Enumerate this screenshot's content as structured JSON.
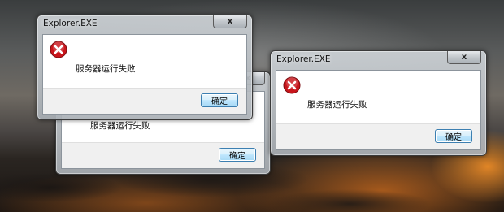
{
  "dialogs": [
    {
      "title": "",
      "message": "服务器运行失败",
      "ok_label": "确定",
      "close_glyph": "x",
      "icon": "error-icon"
    },
    {
      "title": "Explorer.EXE",
      "message": "服务器运行失败",
      "ok_label": "确定",
      "close_glyph": "x",
      "icon": "error-icon"
    },
    {
      "title": "Explorer.EXE",
      "message": "服务器运行失败",
      "ok_label": "确定",
      "close_glyph": "x",
      "icon": "error-icon"
    }
  ],
  "colors": {
    "error_red": "#c8151b",
    "button_border": "#3c7fb1"
  }
}
